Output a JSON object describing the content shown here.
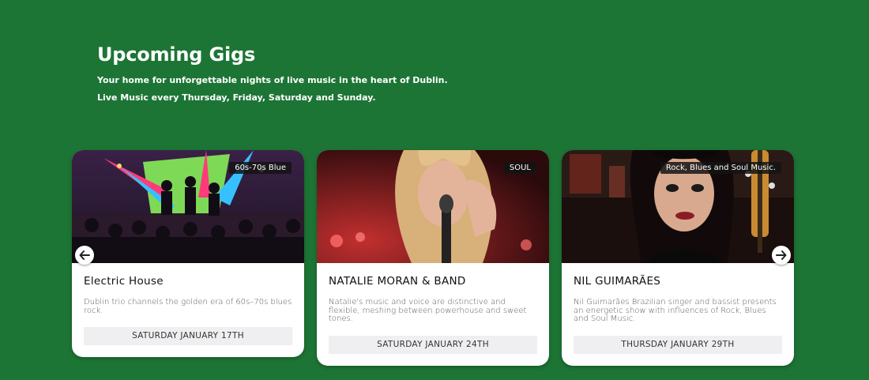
{
  "header": {
    "title": "Upcoming Gigs",
    "line1": "Your home for unforgettable nights of live music in the heart of Dublin.",
    "line2": "Live Music every Thursday, Friday, Saturday and Sunday."
  },
  "cards": [
    {
      "tag": "60s-70s Blue",
      "name": "Electric House",
      "desc": "Dublin trio channels the golden era of 60s–70s blues rock.",
      "date": "SATURDAY JANUARY 17TH"
    },
    {
      "tag": "SOUL",
      "name": "NATALIE MORAN & BAND",
      "desc": "Natalie's music and voice are distinctive and flexible, meshing between powerhouse and sweet tones.",
      "date": "SATURDAY JANUARY 24TH"
    },
    {
      "tag": "Rock, Blues and Soul Music.",
      "name": "NIL GUIMARÃES",
      "desc": "Nil Guimarães Brazilian singer and bassist presents an energetic show with influences of Rock, Blues and Soul Music.",
      "date": "THURSDAY JANUARY 29TH"
    }
  ],
  "icons": {
    "prev": "arrow-left-icon",
    "next": "arrow-right-icon"
  },
  "colors": {
    "background": "#1d7535",
    "card": "#ffffff",
    "date_bg": "#efeef1"
  }
}
